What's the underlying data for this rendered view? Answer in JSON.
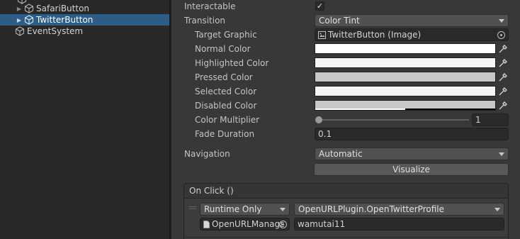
{
  "hierarchy": {
    "items": [
      {
        "label": "SafariButton",
        "has_fold": true,
        "selected": false
      },
      {
        "label": "TwitterButton",
        "has_fold": true,
        "selected": true
      },
      {
        "label": "EventSystem",
        "has_fold": false,
        "selected": false
      }
    ]
  },
  "inspector": {
    "interactable": {
      "label": "Interactable",
      "checked": true,
      "check_glyph": "✓"
    },
    "transition": {
      "label": "Transition",
      "value": "Color Tint"
    },
    "target_graphic": {
      "label": "Target Graphic",
      "value": "TwitterButton (Image)"
    },
    "colors": [
      {
        "label": "Normal Color",
        "color": "#ffffff"
      },
      {
        "label": "Highlighted Color",
        "color": "#f5f5f5"
      },
      {
        "label": "Pressed Color",
        "color": "#c8c8c8"
      },
      {
        "label": "Selected Color",
        "color": "#f5f5f5"
      },
      {
        "label": "Disabled Color",
        "color": "#c8c8c8",
        "alpha": 0.5
      }
    ],
    "color_multiplier": {
      "label": "Color Multiplier",
      "value": "1",
      "fraction": 0.0
    },
    "fade_duration": {
      "label": "Fade Duration",
      "value": "0.1"
    },
    "navigation": {
      "label": "Navigation",
      "value": "Automatic"
    },
    "visualize_button": "Visualize",
    "on_click": {
      "header": "On Click ()",
      "runtime": "Runtime Only",
      "function": "OpenURLPlugin.OpenTwitterProfile",
      "target_object": "OpenURLManagε",
      "argument": "wamutai11"
    }
  },
  "colors": {
    "selection": "#2c5d87",
    "panel_bg": "#383838",
    "hierarchy_bg": "#282828"
  }
}
